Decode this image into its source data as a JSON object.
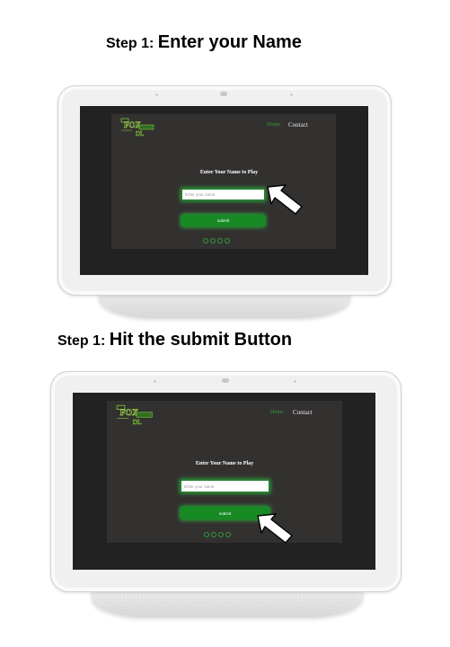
{
  "steps": [
    {
      "prefix": "Step 1:",
      "text": "Enter your Name",
      "app": {
        "logo_icon": "fox-logo-icon",
        "nav": {
          "home": "Home",
          "contact": "Contact"
        },
        "prompt": "Enter Your Name to Play",
        "input_placeholder": "Enter your name",
        "submit_label": "submit",
        "social_icons": [
          "social-icon-1",
          "social-icon-2",
          "social-icon-3",
          "social-icon-4"
        ]
      },
      "pointer_target": "name-input"
    },
    {
      "prefix": "Step 1:",
      "text": "Hit the submit Button",
      "app": {
        "logo_icon": "fox-logo-icon",
        "nav": {
          "home": "Home",
          "contact": "Contact"
        },
        "prompt": "Enter Your Name to Play",
        "input_placeholder": "Enter your name",
        "submit_label": "submit",
        "social_icons": [
          "social-icon-1",
          "social-icon-2",
          "social-icon-3",
          "social-icon-4"
        ]
      },
      "pointer_target": "submit-button"
    }
  ],
  "colors": {
    "accent_green": "#178a24",
    "screen_bg": "#333130",
    "device_frame": "#f0f0f0"
  }
}
